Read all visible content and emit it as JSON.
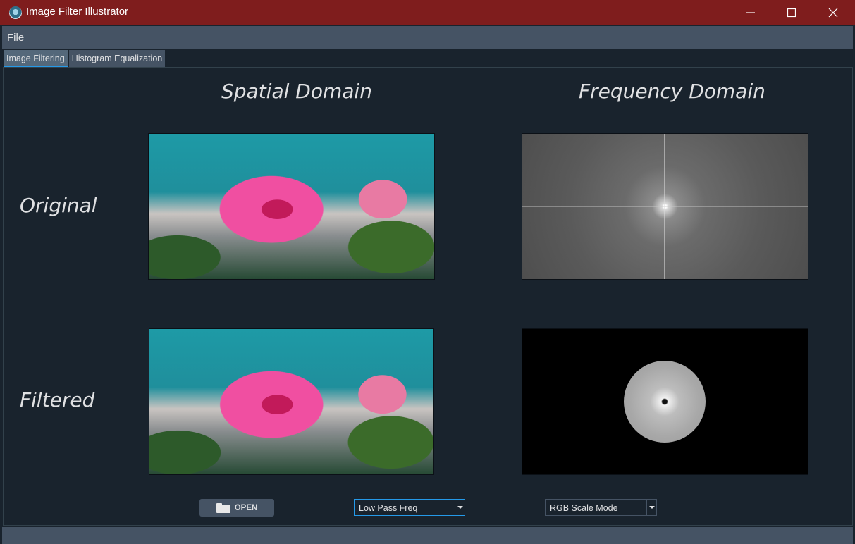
{
  "window": {
    "title": "Image Filter Illustrator"
  },
  "menu": {
    "file": "File"
  },
  "tabs": [
    {
      "label": "Image Filtering",
      "active": true
    },
    {
      "label": "Histogram Equalization",
      "active": false
    }
  ],
  "headings": {
    "spatial": "Spatial Domain",
    "frequency": "Frequency Domain"
  },
  "rows": {
    "original": "Original",
    "filtered": "Filtered"
  },
  "controls": {
    "open_label": "OPEN",
    "filter_mode": "Low Pass Freq",
    "scale_mode": "RGB Scale Mode"
  },
  "colors": {
    "titlebar": "#7f1d1d",
    "accent": "#259ae9",
    "background": "#19232d",
    "surface": "#455364"
  }
}
